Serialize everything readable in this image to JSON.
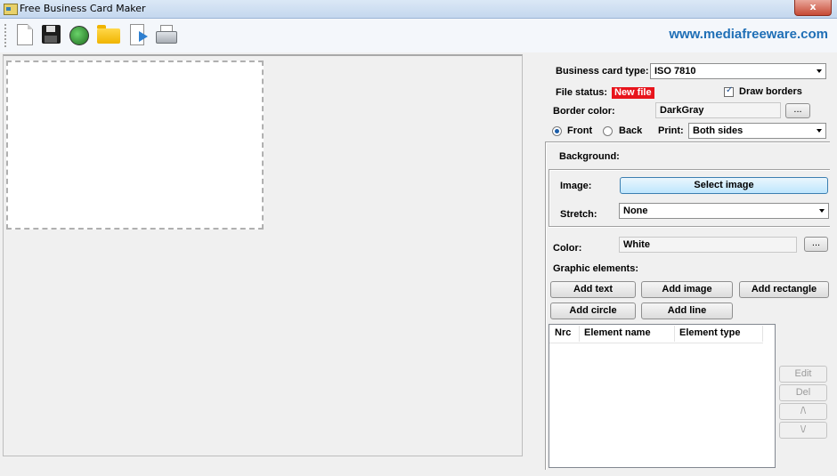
{
  "window": {
    "title": "Free Business Card Maker",
    "close_label": "x"
  },
  "toolbar": {
    "buttons": [
      "new-file-icon",
      "save-icon",
      "globe-icon",
      "open-folder-icon",
      "export-icon",
      "print-icon"
    ],
    "website": "www.mediafreeware.com"
  },
  "settings": {
    "card_type_label": "Business card type:",
    "card_type_value": "ISO 7810",
    "file_status_label": "File status:",
    "file_status_value": "New file",
    "draw_borders_label": "Draw borders",
    "draw_borders_checked": true,
    "border_color_label": "Border color:",
    "border_color_value": "DarkGray",
    "browse_label": "...",
    "front_label": "Front",
    "back_label": "Back",
    "side_selected": "Front",
    "print_label": "Print:",
    "print_value": "Both sides"
  },
  "background": {
    "header": "Background:",
    "image_label": "Image:",
    "select_image_label": "Select image",
    "stretch_label": "Stretch:",
    "stretch_value": "None",
    "color_label": "Color:",
    "color_value": "White",
    "browse_label": "..."
  },
  "graphic": {
    "header": "Graphic elements:",
    "add_text": "Add text",
    "add_image": "Add image",
    "add_rectangle": "Add rectangle",
    "add_circle": "Add circle",
    "add_line": "Add line",
    "columns": [
      "Nrc",
      "Element name",
      "Element type"
    ],
    "rows": [],
    "edit": "Edit",
    "del": "Del",
    "up": "/\\",
    "down": "\\/"
  },
  "colors": {
    "accent": "#1f6fb6",
    "status_badge": "#e8141c"
  }
}
